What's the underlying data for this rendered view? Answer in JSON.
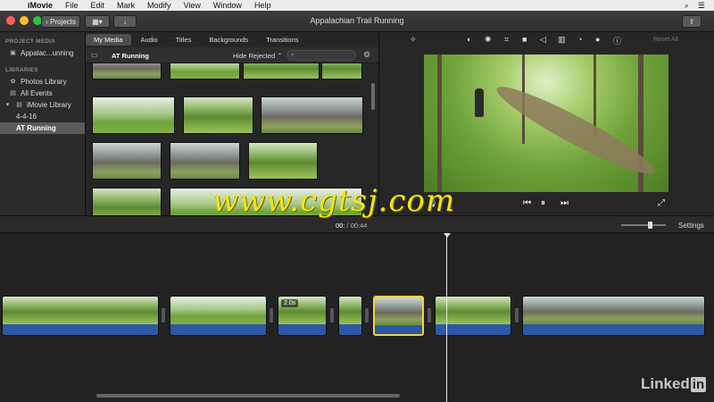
{
  "menubar": {
    "items": [
      "iMovie",
      "File",
      "Edit",
      "Mark",
      "Modify",
      "View",
      "Window",
      "Help"
    ],
    "right_icons": [
      "search-icon",
      "list-icon"
    ]
  },
  "titlebar": {
    "back_label": "Projects",
    "title": "Appalachian Trail Running"
  },
  "sidebar": {
    "project_media_header": "PROJECT MEDIA",
    "project_item": "Appalac...unning",
    "libraries_header": "LIBRARIES",
    "library_items": [
      "Photos Library",
      "All Events",
      "iMovie Library",
      "4-4-16",
      "AT Running"
    ],
    "selected": "AT Running"
  },
  "browser": {
    "tabs": [
      "My Media",
      "Audio",
      "Titles",
      "Backgrounds",
      "Transitions"
    ],
    "active_tab": "My Media",
    "event_title": "AT Running",
    "filter": "Hide Rejected ⌃",
    "search_placeholder": ""
  },
  "viewer": {
    "reset_label": "Reset All",
    "tools": [
      "magic-wand-icon",
      "color-balance-icon",
      "color-correction-icon",
      "crop-icon",
      "stabilization-icon",
      "volume-icon",
      "speed-icon",
      "filter-icon",
      "info-icon"
    ]
  },
  "timeline": {
    "current_time": "00:",
    "total_time": "00:44",
    "settings_label": "Settings",
    "clip_duration_label": "2.0s"
  },
  "watermark": "www.cgtsj.com",
  "brand": {
    "text": "Linked",
    "in": "in"
  },
  "colors": {
    "audio": "#2d58a8",
    "selection": "#f3d43a",
    "accent": "#f0e51b"
  }
}
